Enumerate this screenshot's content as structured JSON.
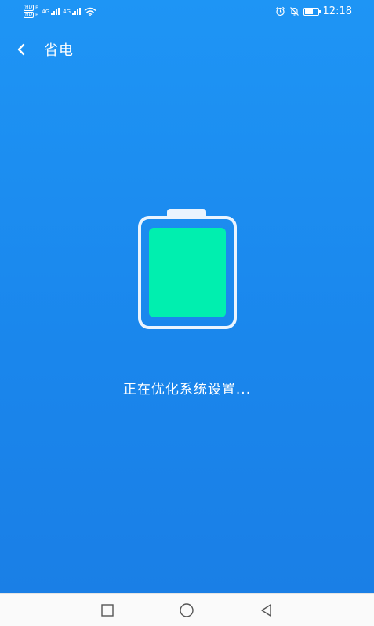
{
  "status_bar": {
    "hd1": "HD",
    "hd1_sub": "B",
    "hd2": "HD",
    "hd2_sub": "B",
    "sim1_type": "4G",
    "sim2_type": "4G",
    "time": "12:18",
    "icons": [
      "alarm-icon",
      "mute-icon",
      "battery-icon"
    ]
  },
  "header": {
    "title": "省电",
    "back_icon": "chevron-left-icon"
  },
  "main": {
    "message": "正在优化系统设置...",
    "colors": {
      "battery_fill": "#00efaf",
      "background": "#1a86ec"
    }
  },
  "nav_bar": {
    "icons": [
      "recents-square-icon",
      "home-circle-icon",
      "back-triangle-icon"
    ]
  }
}
